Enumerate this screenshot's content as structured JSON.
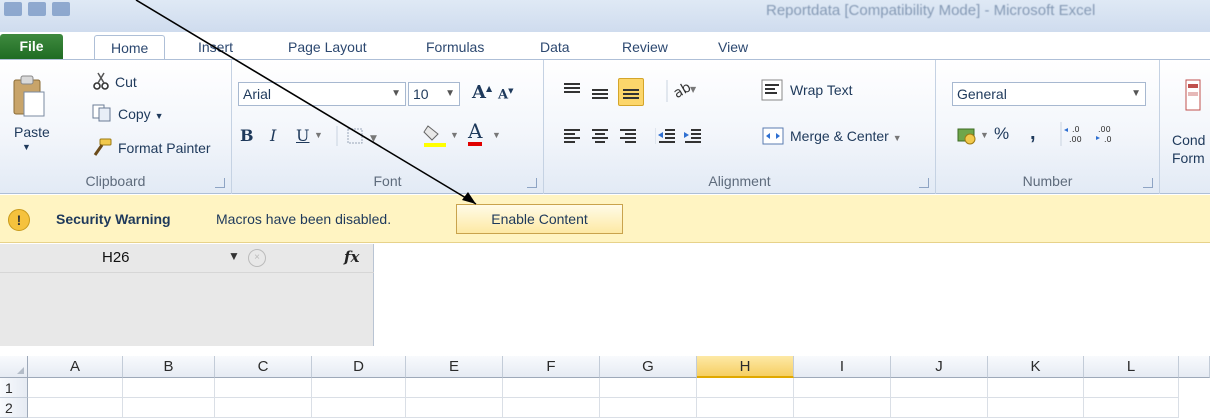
{
  "window": {
    "title": "Reportdata [Compatibility Mode] - Microsoft Excel"
  },
  "tabs": [
    "File",
    "Home",
    "Insert",
    "Page Layout",
    "Formulas",
    "Data",
    "Review",
    "View"
  ],
  "ribbon": {
    "clipboard": {
      "label": "Clipboard",
      "paste": "Paste",
      "cut": "Cut",
      "copy": "Copy",
      "format_painter": "Format Painter"
    },
    "font": {
      "label": "Font",
      "font_name": "Arial",
      "font_size": "10",
      "bold": "B",
      "italic": "I",
      "underline": "U",
      "grow": "A",
      "shrink": "A",
      "color_letter": "A"
    },
    "alignment": {
      "label": "Alignment",
      "wrap_text": "Wrap Text",
      "merge_center": "Merge & Center"
    },
    "number": {
      "label": "Number",
      "format": "General",
      "percent": "%",
      "comma": ","
    },
    "conditional": {
      "line1": "Cond",
      "line2": "Form"
    }
  },
  "security_bar": {
    "title": "Security Warning",
    "message": "Macros have been disabled.",
    "button": "Enable Content"
  },
  "formula_bar": {
    "name_box": "H26",
    "fx": "fx",
    "value": ""
  },
  "grid": {
    "columns": [
      "A",
      "B",
      "C",
      "D",
      "E",
      "F",
      "G",
      "H",
      "I",
      "J",
      "K",
      "L"
    ],
    "selected_column": "H",
    "rows": [
      "1",
      "2"
    ]
  },
  "colors": {
    "file_tab": "#1e6b22",
    "security_bar": "#fff4c2",
    "selected_header": "#f6cf63"
  }
}
